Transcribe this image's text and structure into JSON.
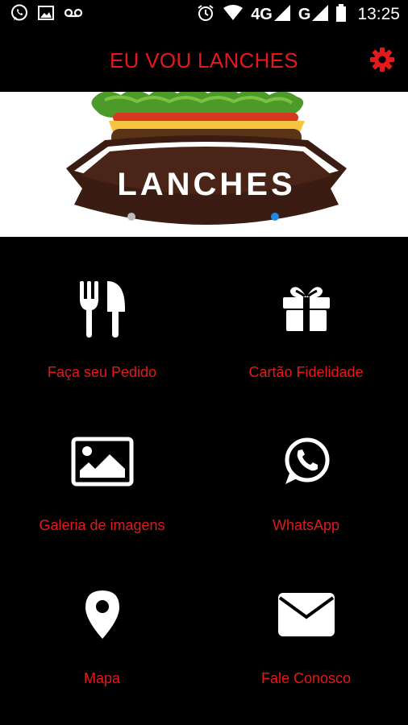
{
  "status_bar": {
    "network_4g": "4G",
    "network_g": "G",
    "time": "13:25",
    "icons": [
      "whatsapp-icon",
      "image-icon",
      "voicemail-icon",
      "alarm-icon",
      "wifi-icon",
      "signal-icon",
      "battery-icon"
    ]
  },
  "app_bar": {
    "title": "EU VOU LANCHES",
    "settings_icon": "gear-icon"
  },
  "banner": {
    "logo_text": "LANCHES",
    "carousel_dots": 2,
    "active_dot": 2
  },
  "menu": {
    "items": [
      {
        "label": "Faça seu Pedido",
        "icon": "utensils-icon"
      },
      {
        "label": "Cartão Fidelidade",
        "icon": "gift-icon"
      },
      {
        "label": "Galeria de imagens",
        "icon": "image-icon"
      },
      {
        "label": "WhatsApp",
        "icon": "whatsapp-icon"
      },
      {
        "label": "Mapa",
        "icon": "map-marker-icon"
      },
      {
        "label": "Fale Conosco",
        "icon": "envelope-icon"
      }
    ]
  },
  "colors": {
    "accent": "#e3191b",
    "background": "#000000",
    "icon": "#ffffff",
    "dot_active": "#1e88e5",
    "dot_inactive": "#bdbdbd"
  }
}
